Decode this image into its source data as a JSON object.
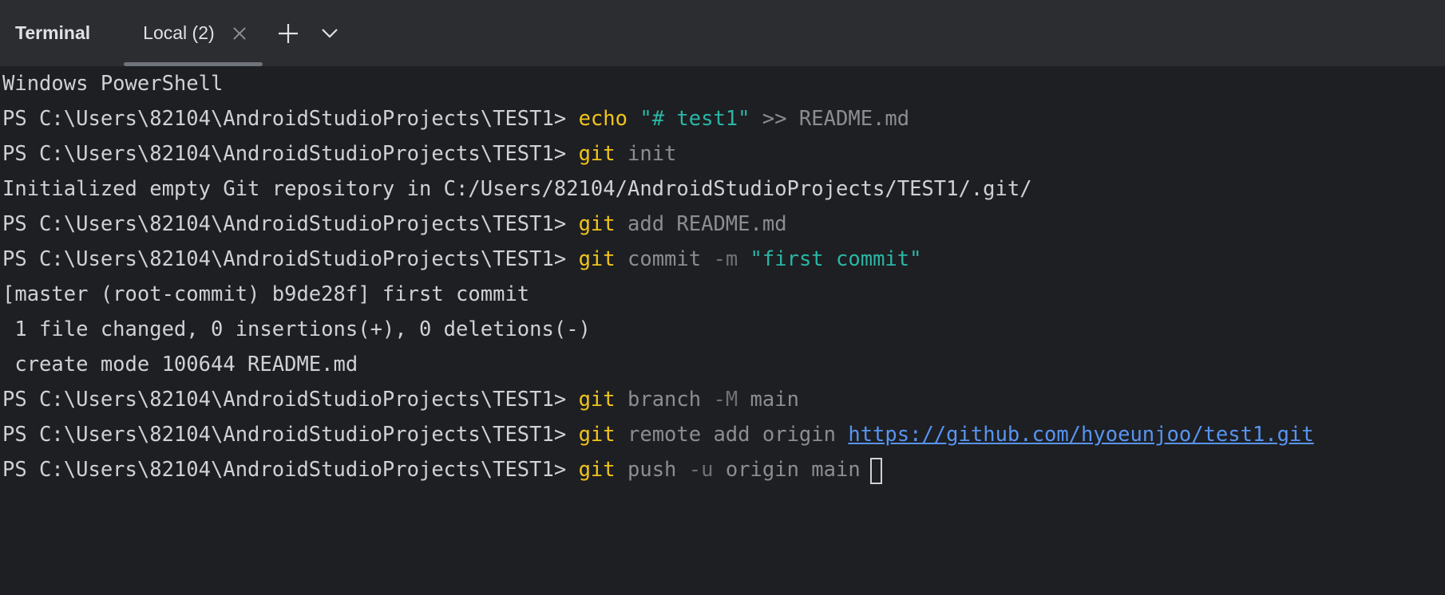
{
  "toolbar": {
    "title": "Terminal",
    "tab_label": "Local (2)",
    "icons": [
      "close-icon",
      "plus-icon",
      "chevron-down-icon"
    ]
  },
  "colors": {
    "background": "#1e1f22",
    "toolbar": "#2b2d30",
    "command": "#f0c41b",
    "string": "#29b6a6",
    "link": "#5794f2"
  },
  "terminal": {
    "prompt": "PS C:\\Users\\82104\\AndroidStudioProjects\\TEST1> ",
    "l0": {
      "out": "Windows PowerShell"
    },
    "l1": {
      "cmd": "echo",
      "str": "\"# test1\"",
      "arg": ">> README.md"
    },
    "l2": {
      "cmd": "git",
      "arg": "init"
    },
    "l3": {
      "out": "Initialized empty Git repository in C:/Users/82104/AndroidStudioProjects/TEST1/.git/"
    },
    "l4": {
      "cmd": "git",
      "arg": "add README.md"
    },
    "l5": {
      "cmd": "git",
      "arg": "commit",
      "opt": "-m",
      "str": "\"first commit\""
    },
    "l6": {
      "out": "[master (root-commit) b9de28f] first commit"
    },
    "l7": {
      "out": " 1 file changed, 0 insertions(+), 0 deletions(-)"
    },
    "l8": {
      "out": " create mode 100644 README.md"
    },
    "l9": {
      "cmd": "git",
      "arg1": "branch",
      "opt": "-M",
      "arg2": "main"
    },
    "l10": {
      "cmd": "git",
      "arg": "remote add origin",
      "link": "https://github.com/hyoeunjoo/test1.git"
    },
    "l11": {
      "cmd": "git",
      "arg1": "push",
      "opt": "-u",
      "arg2": "origin main"
    }
  }
}
